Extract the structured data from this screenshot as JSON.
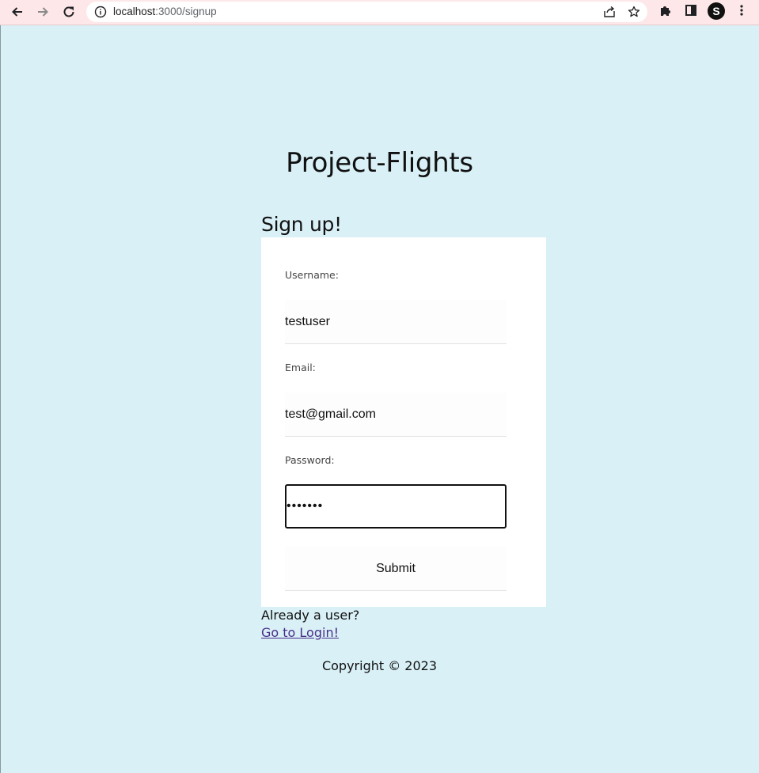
{
  "browser": {
    "url_host": "localhost",
    "url_path": ":3000/signup",
    "profile_initial": "S",
    "icons": [
      "back-icon",
      "forward-icon",
      "reload-icon",
      "info-icon",
      "share-icon",
      "star-icon",
      "extensions-icon",
      "side-panel-icon",
      "menu-icon"
    ]
  },
  "page": {
    "app_title": "Project-Flights",
    "form_heading": "Sign up!",
    "fields": [
      {
        "label": "Username:",
        "value": "testuser"
      },
      {
        "label": "Email:",
        "value": "test@gmail.com"
      },
      {
        "label": "Password:",
        "value": "•••••••"
      }
    ],
    "submit_label": "Submit",
    "already_text": "Already a user?",
    "login_link": "Go to Login!",
    "copyright": "Copyright © 2023"
  },
  "colors": {
    "page_background": "#d8f0f6",
    "chrome_background": "#fde7e8",
    "card_background": "#ffffff",
    "link": "#4a2e8a"
  }
}
